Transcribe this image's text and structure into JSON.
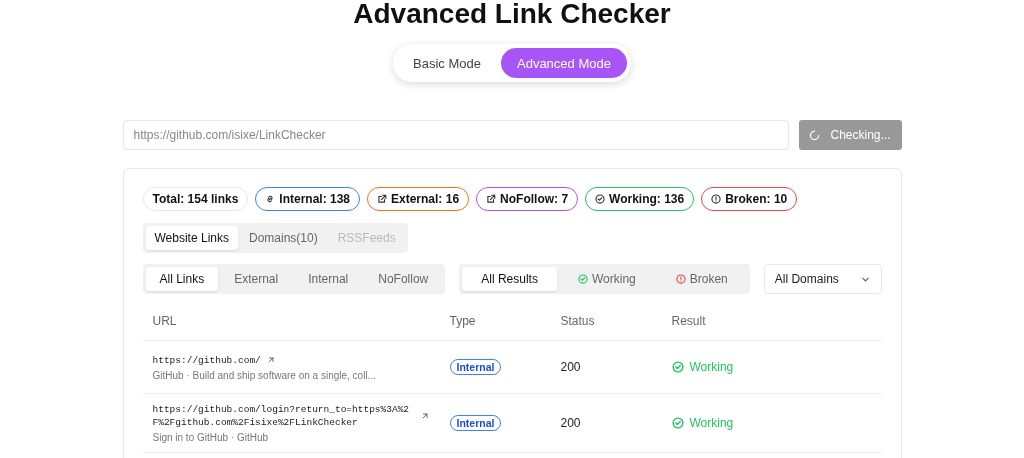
{
  "title": "Advanced Link Checker",
  "modes": [
    {
      "label": "Basic Mode",
      "selected": false
    },
    {
      "label": "Advanced Mode",
      "selected": true
    }
  ],
  "url_field": {
    "value": "https://github.com/isixe/LinkChecker",
    "disabled": true
  },
  "check_button": {
    "label": "Checking...",
    "loading": true
  },
  "stats": [
    {
      "kind": "total",
      "label": "Total: 154 links",
      "color": "#e5e7eb"
    },
    {
      "kind": "link",
      "label": "Internal: 138",
      "color": "#3b82f6"
    },
    {
      "kind": "external",
      "label": "External: 16",
      "color": "#f97316"
    },
    {
      "kind": "external",
      "label": "NoFollow: 7",
      "color": "#a855f7"
    },
    {
      "kind": "check",
      "label": "Working: 136",
      "color": "#22c55e"
    },
    {
      "kind": "alert",
      "label": "Broken: 10",
      "color": "#ef4444"
    }
  ],
  "tabs": [
    {
      "label": "Website Links",
      "selected": true,
      "disabled": false
    },
    {
      "label": "Domains(10)",
      "selected": false,
      "disabled": false
    },
    {
      "label": "RSSFeeds",
      "selected": false,
      "disabled": true
    }
  ],
  "type_filter": [
    {
      "label": "All Links",
      "selected": true
    },
    {
      "label": "External",
      "selected": false
    },
    {
      "label": "Internal",
      "selected": false
    },
    {
      "label": "NoFollow",
      "selected": false
    }
  ],
  "result_filter": [
    {
      "label": "All Results",
      "selected": true,
      "kind": "plain"
    },
    {
      "label": "Working",
      "selected": false,
      "kind": "check"
    },
    {
      "label": "Broken",
      "selected": false,
      "kind": "alert"
    }
  ],
  "domain_select": {
    "value": "All Domains"
  },
  "table": {
    "columns": [
      "URL",
      "Type",
      "Status",
      "Result"
    ],
    "rows": [
      {
        "url": "https://github.com/",
        "title": "GitHub · Build and ship software on a single, coll...",
        "type": "Internal",
        "status": "200",
        "result": "Working",
        "kind": "working"
      },
      {
        "url": "https://github.com/login?return_to=https%3A%2F%2Fgithub.com%2Fisixe%2FLinkChecker",
        "title": "Sign in to GitHub · GitHub",
        "type": "Internal",
        "status": "200",
        "result": "Working",
        "kind": "working"
      }
    ]
  }
}
